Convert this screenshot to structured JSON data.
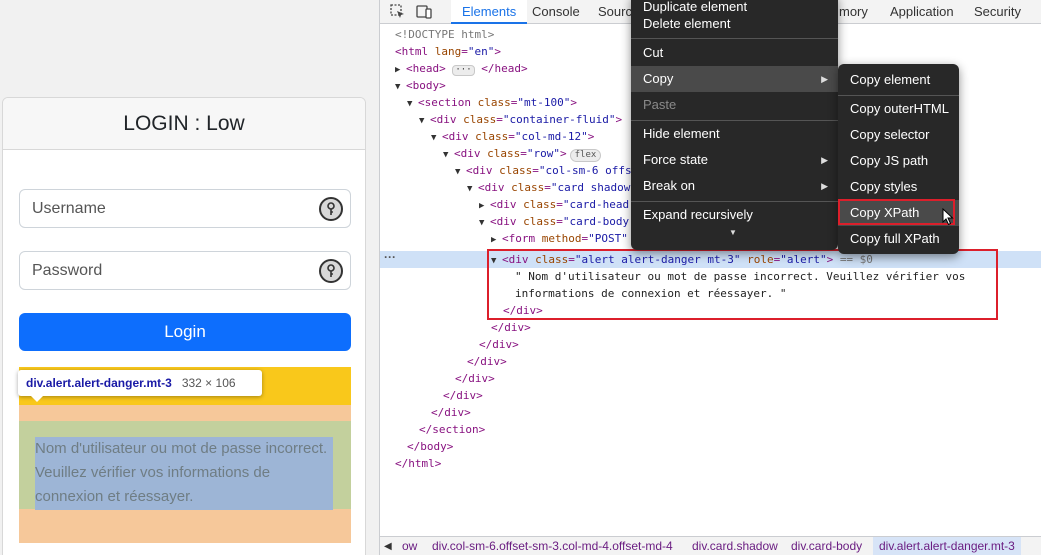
{
  "page": {
    "card_title": "LOGIN : Low",
    "username_placeholder": "Username",
    "password_placeholder": "Password",
    "login_label": "Login",
    "alert_text": "Nom d'utilisateur ou mot de passe incorrect. Veuillez vérifier vos informations de connexion et réessayer.",
    "tooltip": {
      "selector": "div.alert.alert-danger.mt-3",
      "size": "332 × 106"
    }
  },
  "devtools": {
    "tabs": [
      "Elements",
      "Console",
      "Source",
      "mory",
      "Application",
      "Security"
    ],
    "active_tab": "Elements",
    "selected_suffix": "== $0",
    "badge_flex": "flex",
    "breadcrumbs": [
      "ow",
      "div.col-sm-6.offset-sm-3.col-md-4.offset-md-4",
      "div.card.shadow",
      "div.card-body",
      "div.alert.alert-danger.mt-3"
    ]
  },
  "context_menu": {
    "items": [
      {
        "label": "Duplicate element"
      },
      {
        "label": "Delete element"
      },
      {
        "label": "Cut"
      },
      {
        "label": "Copy"
      },
      {
        "label": "Paste"
      },
      {
        "label": "Hide element"
      },
      {
        "label": "Force state"
      },
      {
        "label": "Break on"
      },
      {
        "label": "Expand recursively"
      }
    ]
  },
  "copy_submenu": {
    "items": [
      {
        "label": "Copy element"
      },
      {
        "label": "Copy outerHTML"
      },
      {
        "label": "Copy selector"
      },
      {
        "label": "Copy JS path"
      },
      {
        "label": "Copy styles"
      },
      {
        "label": "Copy XPath"
      },
      {
        "label": "Copy full XPath"
      }
    ]
  }
}
